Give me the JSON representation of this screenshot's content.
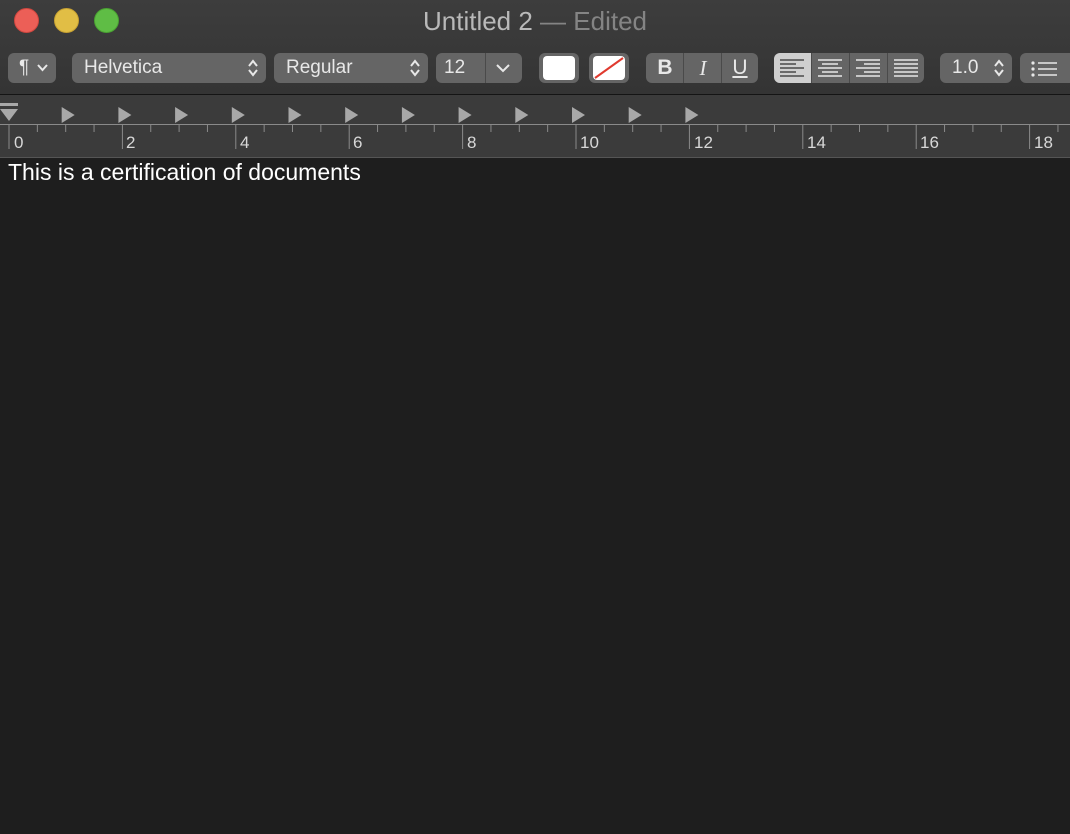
{
  "window": {
    "title": "Untitled 2",
    "status": " — Edited"
  },
  "toolbar": {
    "paragraph_styles_icon": "pilcrow-icon",
    "font_family": "Helvetica",
    "font_style": "Regular",
    "font_size": "12",
    "text_color": "#ffffff",
    "bold_label": "B",
    "italic_label": "I",
    "underline_label": "U",
    "alignment_selected": "left",
    "line_spacing": "1.0",
    "list_icon": "bullet-list-icon"
  },
  "ruler": {
    "labels": [
      "0",
      "2",
      "4",
      "6",
      "8",
      "10",
      "12",
      "14",
      "16",
      "18"
    ]
  },
  "document": {
    "text": "This is a certification of documents"
  },
  "colors": {
    "close": "#ec5f57",
    "minimize": "#e1be45",
    "maximize": "#5fbd45",
    "background": "#1e1e1e"
  }
}
